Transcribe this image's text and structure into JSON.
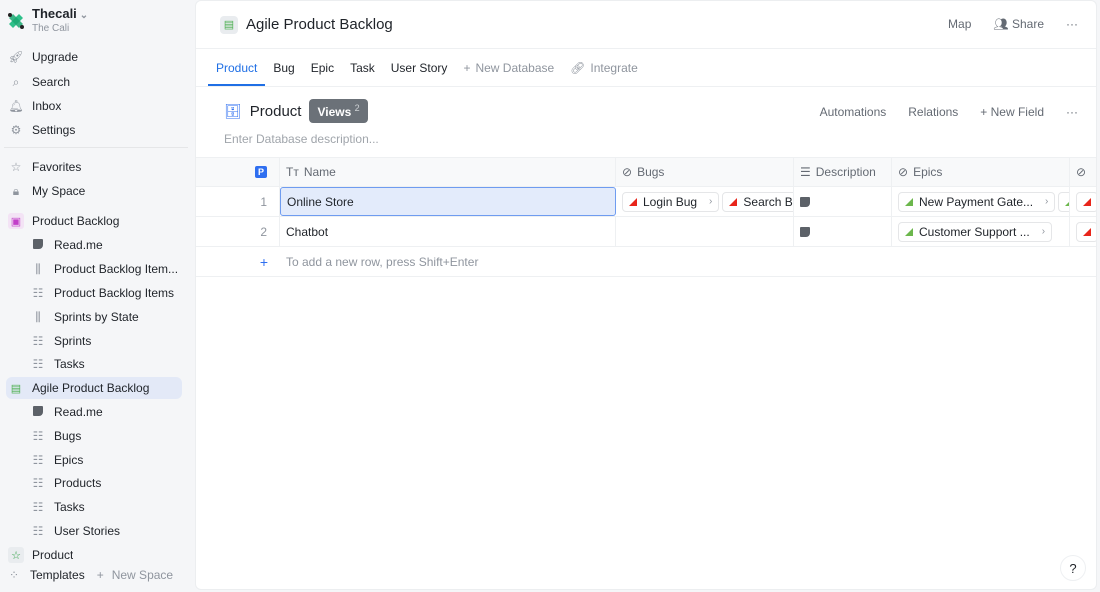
{
  "workspace": {
    "name": "Thecali",
    "subtitle": "The Cali"
  },
  "sidebar": {
    "top_items": [
      {
        "label": "Upgrade",
        "icon": "rocket-icon"
      },
      {
        "label": "Search",
        "icon": "search-icon"
      },
      {
        "label": "Inbox",
        "icon": "bell-icon"
      },
      {
        "label": "Settings",
        "icon": "gear-icon"
      }
    ],
    "favorites": "Favorites",
    "my_space": "My Space",
    "spaces": [
      {
        "label": "Product Backlog",
        "children": [
          {
            "label": "Read.me",
            "icon": "doc-icon"
          },
          {
            "label": "Product Backlog Item...",
            "icon": "kanban-icon"
          },
          {
            "label": "Product Backlog Items",
            "icon": "table-icon"
          },
          {
            "label": "Sprints by State",
            "icon": "kanban-icon"
          },
          {
            "label": "Sprints",
            "icon": "table-icon"
          },
          {
            "label": "Tasks",
            "icon": "table-icon"
          }
        ]
      },
      {
        "label": "Agile Product Backlog",
        "active": true,
        "children": [
          {
            "label": "Read.me",
            "icon": "doc-icon"
          },
          {
            "label": "Bugs",
            "icon": "table-icon"
          },
          {
            "label": "Epics",
            "icon": "table-icon"
          },
          {
            "label": "Products",
            "icon": "table-icon"
          },
          {
            "label": "Tasks",
            "icon": "table-icon"
          },
          {
            "label": "User Stories",
            "icon": "table-icon"
          }
        ]
      },
      {
        "label": "Product"
      }
    ],
    "footer": {
      "templates": "Templates",
      "new_space": "New Space"
    }
  },
  "header": {
    "title": "Agile Product Backlog",
    "map": "Map",
    "share": "Share",
    "more": "···"
  },
  "tabs": [
    {
      "label": "Product",
      "active": true
    },
    {
      "label": "Bug"
    },
    {
      "label": "Epic"
    },
    {
      "label": "Task"
    },
    {
      "label": "User Story"
    }
  ],
  "tab_actions": {
    "new_database": "New Database",
    "integrate": "Integrate"
  },
  "database": {
    "title": "Product",
    "views_label": "Views",
    "views_count": "2",
    "description_placeholder": "Enter Database description...",
    "actions": {
      "automations": "Automations",
      "relations": "Relations",
      "new_field": "New Field",
      "more": "···"
    }
  },
  "table": {
    "columns": {
      "name": "Name",
      "bugs": "Bugs",
      "description": "Description",
      "epics": "Epics"
    },
    "rows": [
      {
        "index": "1",
        "name": "Online Store",
        "bugs": [
          "Login Bug",
          "Search Bu"
        ],
        "epics": [
          "New Payment Gate..."
        ]
      },
      {
        "index": "2",
        "name": "Chatbot",
        "bugs": [],
        "epics": [
          "Customer Support ..."
        ]
      }
    ],
    "add_row_hint": "To add a new row, press Shift+Enter"
  },
  "help": "?"
}
